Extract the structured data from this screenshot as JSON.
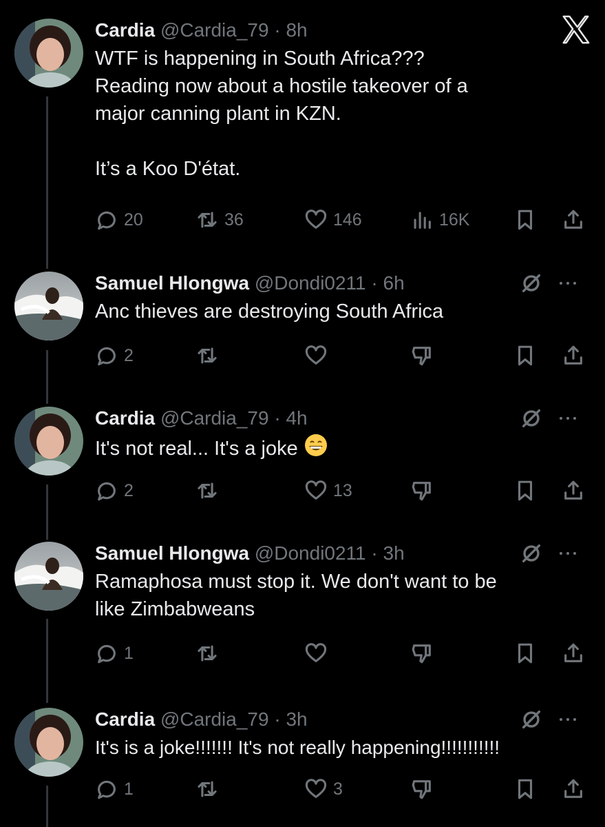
{
  "brand": {
    "logo": "x-logo-icon"
  },
  "colors": {
    "background": "#000000",
    "text": "#e7e9ea",
    "muted": "#71767b",
    "thread_line": "#333639"
  },
  "tweets": [
    {
      "name": "Cardia",
      "handle": "@Cardia_79",
      "separator": "·",
      "time": "8h",
      "text": "WTF is happening in South Africa???\nReading now about a hostile takeover of a\nmajor canning plant in KZN.\n\nIt’s a Koo D'état.",
      "replies": "20",
      "reposts": "36",
      "likes": "146",
      "views": "16K"
    },
    {
      "name": "Samuel Hlongwa",
      "handle": "@Dondi0211",
      "separator": "·",
      "time": "6h",
      "text": "Anc thieves are destroying South Africa",
      "replies": "2",
      "reposts": "",
      "likes": ""
    },
    {
      "name": "Cardia",
      "handle": "@Cardia_79",
      "separator": "·",
      "time": "4h",
      "text": "It's not real... It's a joke ",
      "emoji": "grinning-face-emoji",
      "replies": "2",
      "reposts": "",
      "likes": "13"
    },
    {
      "name": "Samuel Hlongwa",
      "handle": "@Dondi0211",
      "separator": "·",
      "time": "3h",
      "text": "Ramaphosa must stop it. We don't want to be\nlike Zimbabweans",
      "replies": "1",
      "reposts": "",
      "likes": ""
    },
    {
      "name": "Cardia",
      "handle": "@Cardia_79",
      "separator": "·",
      "time": "3h",
      "text": "It's is a joke!!!!!!! It's not really happening!!!!!!!!!!!",
      "replies": "1",
      "reposts": "",
      "likes": "3"
    }
  ]
}
